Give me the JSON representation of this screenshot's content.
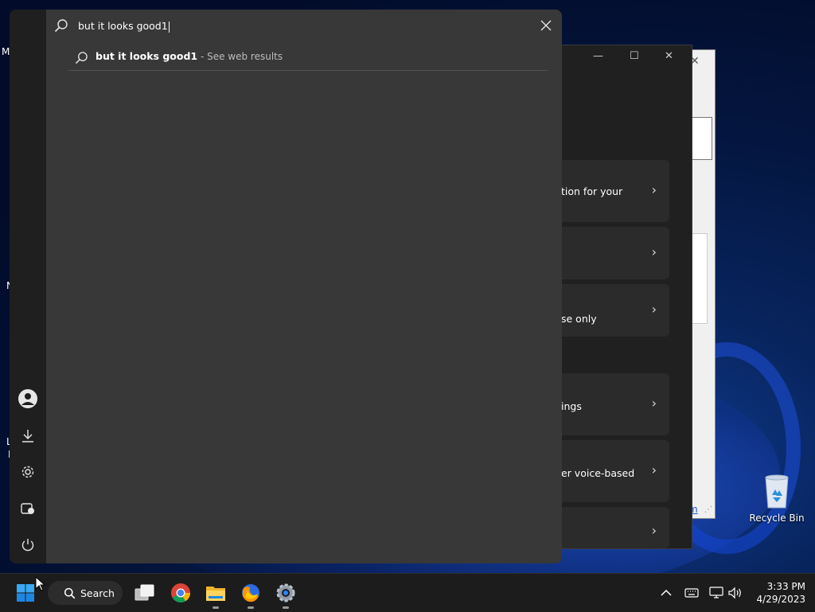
{
  "desktop": {
    "edge_letters": [
      "M",
      "N",
      "L",
      "I"
    ],
    "recycle_bin_label": "Recycle Bin"
  },
  "background_window": {
    "link_fragment": "m"
  },
  "settings_window": {
    "cards": [
      {
        "label": "tion for your"
      },
      {
        "label": ""
      },
      {
        "label": "se only"
      },
      {
        "label": "ings"
      },
      {
        "label": "er voice-based"
      },
      {
        "label": ""
      }
    ]
  },
  "start_menu": {
    "search_query": "but it looks good1",
    "result": {
      "query": "but it looks good1",
      "suffix": " - See web results"
    },
    "rail_icons": [
      "user-avatar-icon",
      "downloads-icon",
      "settings-icon",
      "gallery-icon",
      "power-icon"
    ]
  },
  "taskbar": {
    "search_label": "Search",
    "apps": [
      "start-icon",
      "task-view-icon",
      "chrome-icon",
      "file-explorer-icon",
      "firefox-icon",
      "settings-app-icon"
    ],
    "tray_icons": [
      "chevron-up-icon",
      "keyboard-icon",
      "network-icon",
      "volume-icon"
    ],
    "time": "3:33 PM",
    "date": "4/29/2023"
  },
  "colors": {
    "accent": "#0078d4",
    "panel": "#383838",
    "taskbar": "#1c1c1c"
  }
}
